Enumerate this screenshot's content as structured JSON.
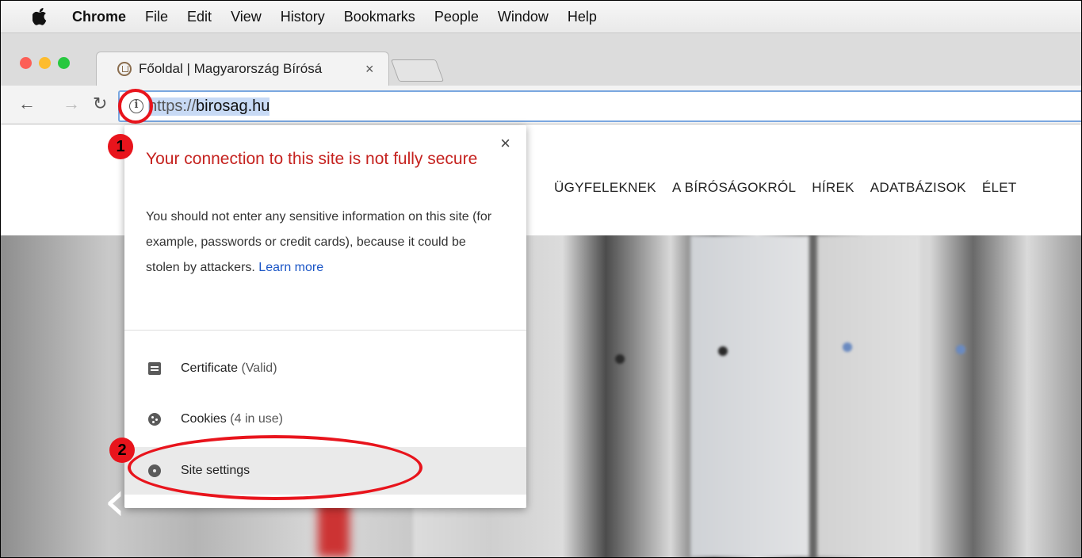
{
  "menubar": {
    "app": "Chrome",
    "items": [
      "File",
      "Edit",
      "View",
      "History",
      "Bookmarks",
      "People",
      "Window",
      "Help"
    ]
  },
  "tab": {
    "title": "Főoldal | Magyarország Bírósá",
    "close": "×"
  },
  "address": {
    "scheme": "https://",
    "host": "birosag.hu"
  },
  "site": {
    "nav": [
      "ÜGYFELEKNEK",
      "A BÍRÓSÁGOKRÓL",
      "HÍREK",
      "ADATBÁZISOK",
      "ÉLET"
    ],
    "carousel_prev": "‹"
  },
  "popup": {
    "close": "×",
    "heading": "Your connection to this site is not fully secure",
    "description": "You should not enter any sensitive information on this site (for example, passwords or credit cards), because it could be stolen by attackers.",
    "learn_more": "Learn more",
    "certificate_label": "Certificate",
    "certificate_status": "(Valid)",
    "cookies_label": "Cookies",
    "cookies_status": "(4 in use)",
    "site_settings_label": "Site settings"
  },
  "annotations": {
    "step1": "1",
    "step2": "2"
  },
  "colors": {
    "warning": "#c5221f",
    "link": "#1a55c6",
    "annotation": "#e8141c"
  }
}
